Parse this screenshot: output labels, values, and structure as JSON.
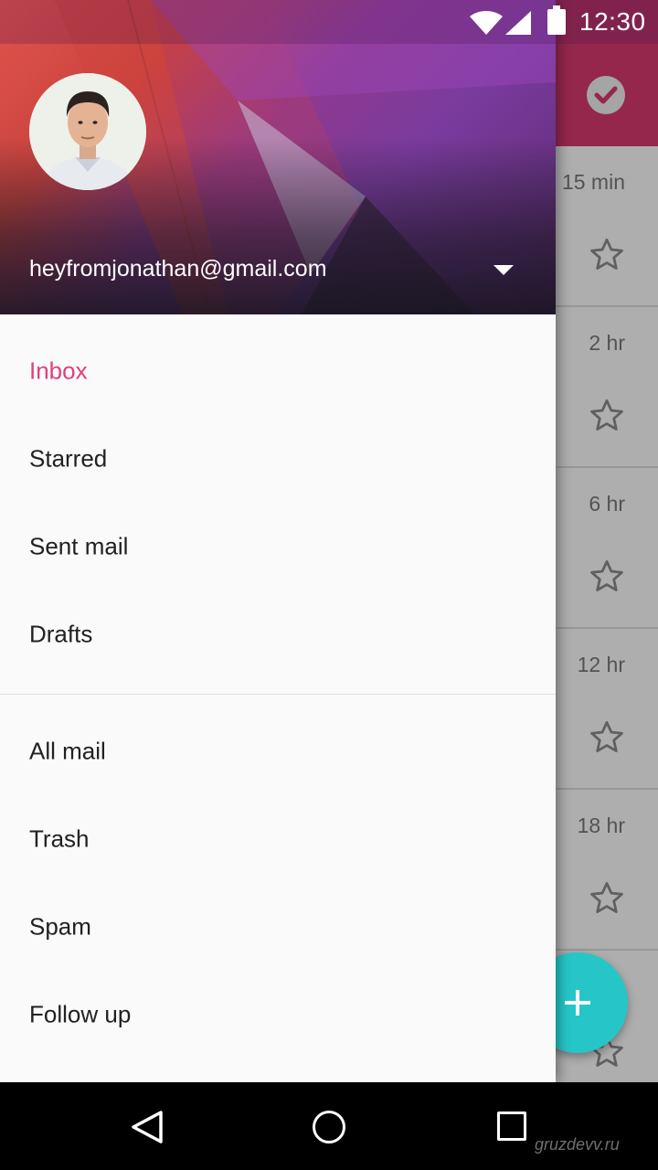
{
  "status_bar": {
    "time": "12:30",
    "icons": [
      "wifi-icon",
      "signal-icon",
      "battery-icon"
    ]
  },
  "account": {
    "email": "heyfromjonathan@gmail.com",
    "avatar": "avatar-photo",
    "dropdown_icon": "dropdown-arrow-icon"
  },
  "nav": {
    "primary": [
      {
        "label": "Inbox",
        "active": true
      },
      {
        "label": "Starred",
        "active": false
      },
      {
        "label": "Sent mail",
        "active": false
      },
      {
        "label": "Drafts",
        "active": false
      }
    ],
    "secondary": [
      {
        "label": "All mail"
      },
      {
        "label": "Trash"
      },
      {
        "label": "Spam"
      },
      {
        "label": "Follow up"
      }
    ]
  },
  "background_list": {
    "times": [
      "15 min",
      "2 hr",
      "6 hr",
      "12 hr",
      "18 hr"
    ],
    "star_icon": "star-outline-icon",
    "toolbar_icon": "check-circle-icon",
    "fab_icon": "plus-icon"
  },
  "system_nav": {
    "icons": [
      "back-icon",
      "home-icon",
      "recents-icon"
    ]
  },
  "watermark": "gruzdevv.ru",
  "colors": {
    "accent": "#e0407b",
    "toolbar": "#d6396e",
    "fab": "#26c6c8"
  }
}
